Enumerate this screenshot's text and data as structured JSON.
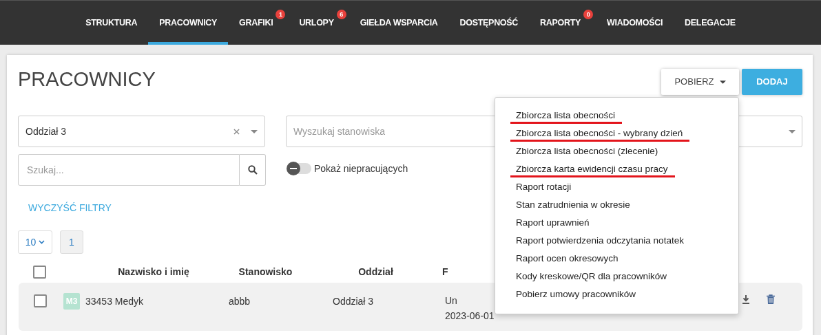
{
  "nav": [
    {
      "label": "STRUKTURA",
      "selected": false
    },
    {
      "label": "PRACOWNICY",
      "selected": true
    },
    {
      "label": "GRAFIKI",
      "selected": false,
      "badge": "1"
    },
    {
      "label": "URLOPY",
      "selected": false,
      "badge": "6"
    },
    {
      "label": "GIEŁDA WSPARCIA",
      "selected": false
    },
    {
      "label": "DOSTĘPNOŚĆ",
      "selected": false
    },
    {
      "label": "RAPORTY",
      "selected": false,
      "badge": "0"
    },
    {
      "label": "WIADOMOŚCI",
      "selected": false
    },
    {
      "label": "DELEGACJE",
      "selected": false
    }
  ],
  "page_title": "PRACOWNICY",
  "download_button": {
    "label": "POBIERZ",
    "expanded": true
  },
  "add_button": {
    "label": "DODAJ"
  },
  "download_menu": [
    {
      "label": "Zbiorcza lista obecności",
      "marked": true
    },
    {
      "label": "Zbiorcza lista obecności - wybrany dzień",
      "marked": true
    },
    {
      "label": "Zbiorcza lista obecności (zlecenie)",
      "marked": false
    },
    {
      "label": "Zbiorcza karta ewidencji czasu pracy",
      "marked": true
    },
    {
      "label": "Raport rotacji",
      "marked": false
    },
    {
      "label": "Stan zatrudnienia w okresie",
      "marked": false
    },
    {
      "label": "Raport uprawnień",
      "marked": false
    },
    {
      "label": "Raport potwierdzenia odczytania notatek",
      "marked": false
    },
    {
      "label": "Raport ocen okresowych",
      "marked": false
    },
    {
      "label": "Kody kreskowe/QR dla pracowników",
      "marked": false
    },
    {
      "label": "Pobierz umowy pracowników",
      "marked": false
    }
  ],
  "filters": {
    "department": {
      "value": "Oddział 3"
    },
    "position": {
      "placeholder": "Wyszukaj stanowiska"
    },
    "search": {
      "placeholder": "Szukaj..."
    },
    "inactive_toggle": {
      "label": "Pokaż niepracujących",
      "on": false
    },
    "clear_label": "WYCZYŚĆ FILTRY"
  },
  "pagination": {
    "page_size": "10",
    "pages": [
      {
        "label": "1",
        "selected": true
      }
    ]
  },
  "table": {
    "select_all": false,
    "columns": [
      "Nazwisko i imię",
      "Stanowisko",
      "Oddział",
      "F"
    ],
    "rows": [
      {
        "checked": false,
        "avatar": "M3",
        "name": "33453 Medyk",
        "position": "abbb",
        "department": "Oddział 3",
        "column_4": [
          "Un",
          "2023-06-01"
        ]
      }
    ]
  }
}
